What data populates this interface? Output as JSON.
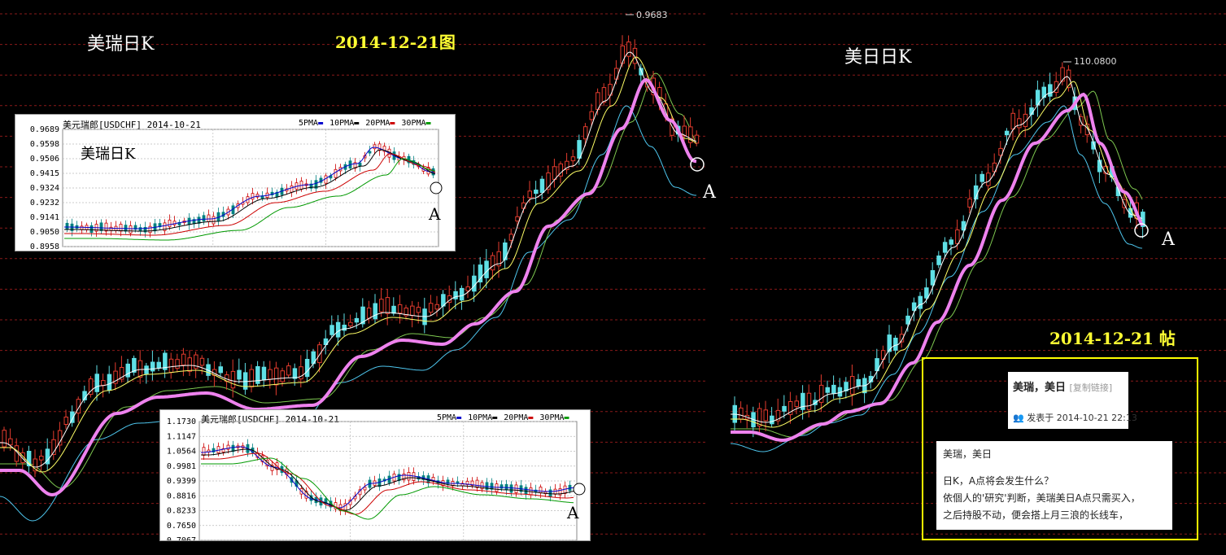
{
  "labels": {
    "usdchf_daily": "美瑞日K",
    "usdjpy_daily": "美日日K",
    "chart_date": "2014-12-21图",
    "post_date": "2014-12-21 帖",
    "point_a": "A"
  },
  "peaks": {
    "usdchf": "0.9683",
    "usdjpy": "110.0800"
  },
  "colors": {
    "background": "#000000",
    "grid": "#8a1a1a",
    "up_candle": "#e23b2e",
    "down_candle": "#5fe0e6",
    "ma5": "#ffffff",
    "ma10": "#ffff66",
    "ma20": "#7ec850",
    "ma_slow": "#4ec6ee",
    "ma_thick": "#ee82ee",
    "label_yellow": "#ffff33",
    "post_border": "#ffff00"
  },
  "inset_chf": {
    "header": "美元瑞郎[USDCHF] 2014-10-21",
    "watermark": "美瑞日K",
    "legend": [
      "5PMA",
      "10PMA",
      "20PMA",
      "30PMA"
    ],
    "legend_colors": [
      "#0000cc",
      "#000000",
      "#cc0000",
      "#009900"
    ],
    "yticks": [
      "0.9689",
      "0.9598",
      "0.9506",
      "0.9415",
      "0.9324",
      "0.9232",
      "0.9141",
      "0.9050",
      "0.8958"
    ],
    "point": "A"
  },
  "inset_jpy": {
    "header": "美元瑞郎[USDCHF] 2014-10-21",
    "legend": [
      "5PMA",
      "10PMA",
      "20PMA",
      "30PMA"
    ],
    "legend_colors": [
      "#0000cc",
      "#000000",
      "#cc0000",
      "#009900"
    ],
    "yticks": [
      "1.1730",
      "1.1147",
      "1.0564",
      "0.9981",
      "0.9399",
      "0.8816",
      "0.8233",
      "0.7650",
      "0.7067"
    ],
    "point": "A"
  },
  "post": {
    "title": "美瑞，美日",
    "copy_link": "[复制链接]",
    "posted_label": "发表于",
    "posted_time": "2014-10-21 22:13",
    "line1": "美瑞，美日",
    "line2": "日K，A点将会发生什么？",
    "line3": "依個人的'研究'判断，美瑞美日A点只需买入，",
    "line4": "之后持股不动，便会搭上月三浪的长线车，"
  },
  "chart_data": [
    {
      "type": "candlestick",
      "title": "美瑞日K",
      "peak_value": 0.9683,
      "series": [
        {
          "name": "",
          "trend": "rising",
          "points": [
            0.74,
            0.75,
            0.76,
            0.78,
            0.8,
            0.81,
            0.8,
            0.81,
            0.82,
            0.84,
            0.86,
            0.88,
            0.9,
            0.92,
            0.94,
            0.96,
            0.9683,
            0.95,
            0.93
          ]
        }
      ]
    },
    {
      "type": "candlestick",
      "title": "美元瑞郎[USDCHF] 2014-10-21",
      "ylim": [
        0.8958,
        0.9689
      ],
      "yticks": [
        0.9689,
        0.9598,
        0.9506,
        0.9415,
        0.9324,
        0.9232,
        0.9141,
        0.905,
        0.8958
      ],
      "series_names": [
        "5PMA",
        "10PMA",
        "20PMA",
        "30PMA"
      ]
    },
    {
      "type": "candlestick",
      "title": "美元瑞郎[USDCHF] 2014-10-21",
      "ylim": [
        0.7067,
        1.173
      ],
      "yticks": [
        1.173,
        1.1147,
        1.0564,
        0.9981,
        0.9399,
        0.8816,
        0.8233,
        0.765,
        0.7067
      ],
      "series_names": [
        "5PMA",
        "10PMA",
        "20PMA",
        "30PMA"
      ]
    },
    {
      "type": "candlestick",
      "title": "美日日K",
      "peak_value": 110.08
    }
  ]
}
